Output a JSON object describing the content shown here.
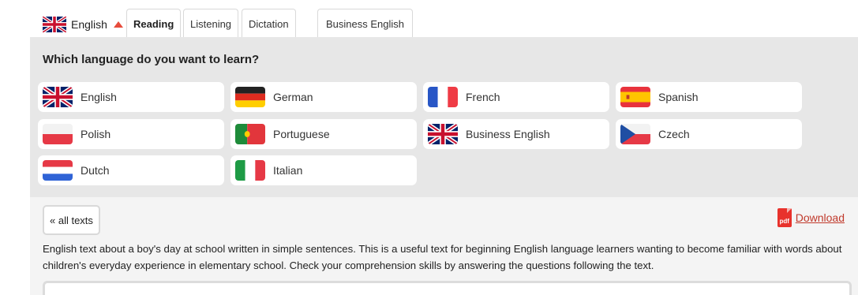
{
  "header": {
    "language_selector": {
      "label": "English"
    },
    "tabs": [
      {
        "label": "Reading",
        "active": true
      },
      {
        "label": "Listening",
        "active": false
      },
      {
        "label": "Dictation",
        "active": false
      },
      {
        "label": "Business English",
        "active": false
      }
    ]
  },
  "language_panel": {
    "question": "Which language do you want to learn?",
    "languages": [
      {
        "label": "English",
        "flag": "uk-flag-icon"
      },
      {
        "label": "German",
        "flag": "german-flag-icon"
      },
      {
        "label": "French",
        "flag": "french-flag-icon"
      },
      {
        "label": "Spanish",
        "flag": "spanish-flag-icon"
      },
      {
        "label": "Polish",
        "flag": "polish-flag-icon"
      },
      {
        "label": "Portuguese",
        "flag": "portuguese-flag-icon"
      },
      {
        "label": "Business English",
        "flag": "uk-flag-icon"
      },
      {
        "label": "Czech",
        "flag": "czech-flag-icon"
      },
      {
        "label": "Dutch",
        "flag": "dutch-flag-icon"
      },
      {
        "label": "Italian",
        "flag": "italian-flag-icon"
      }
    ]
  },
  "content": {
    "back_link": "« all texts",
    "download": {
      "icon_text": "pdf",
      "label": "Download"
    },
    "description": "English text about a boy's day at school written in simple sentences. This is a useful text for beginning English language learners wanting to become familiar with words about children's everyday experience in elementary school. Check your comprehension skills by answering the questions following the text."
  },
  "colors": {
    "accent_red": "#e74c3c",
    "link_red": "#c0392b",
    "panel_gray": "#e7e7e7"
  }
}
